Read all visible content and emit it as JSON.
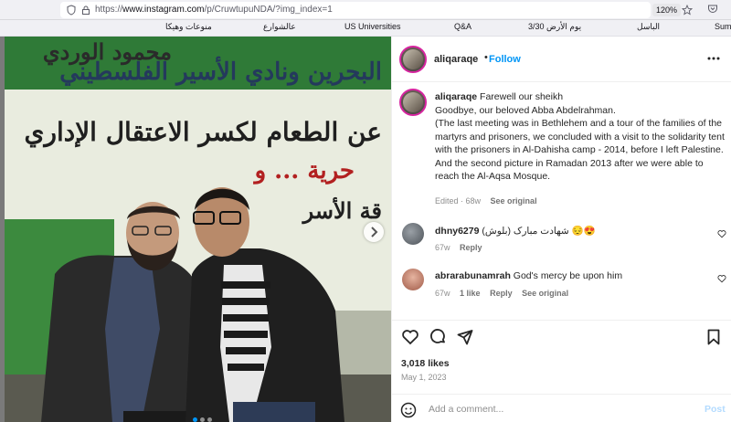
{
  "browser": {
    "url_prefix": "https://",
    "url_host": "www.instagram.com",
    "url_path": "/p/CruwtupuNDA/?img_index=1",
    "zoom": "120%",
    "bookmarks": [
      "Sum",
      "الباسل",
      "يوم الأرض 3/30",
      "Q&A",
      "US Universities",
      "عالشوارع",
      "منوعات وهيكا"
    ]
  },
  "post": {
    "username": "aliqaraqe",
    "follow_label": "Follow",
    "caption_lines": [
      "Farewell our sheikh",
      "Goodbye, our beloved Abba Abdelrahman.",
      "(The last meeting was in Bethlehem and a tour of the families of the martyrs and prisoners, we concluded with a visit to the solidarity tent with the prisoners in Al-Dahisha camp - 2014, before I left Palestine.",
      "And the second picture in Ramadan 2013 after we were able to reach the Al-Aqsa Mosque."
    ],
    "caption_meta": {
      "edited": "Edited · 68w",
      "see_original": "See original"
    },
    "comments": [
      {
        "username": "dhny6279",
        "text": "شهادت مبارک (بلوش) 😔😍",
        "time": "67w",
        "likes": "",
        "reply": "Reply",
        "see_original": ""
      },
      {
        "username": "abrarabunamrah",
        "text": "God's mercy be upon him",
        "time": "67w",
        "likes": "1 like",
        "reply": "Reply",
        "see_original": "See original"
      }
    ],
    "likes": "3,018 likes",
    "date": "May 1, 2023",
    "comment_placeholder": "Add a comment...",
    "post_label": "Post"
  },
  "photo": {
    "banner_lines": [
      "محمود الوردي",
      "البحرين ونادي الأسير الفلسطيني",
      "عن الطعام لكسر الاعتقال الإداري",
      "حرية ... و",
      "قة الأسر"
    ],
    "carousel_count": 3,
    "carousel_active": 0
  },
  "icons": {
    "address": [
      "shield-icon",
      "lock-icon",
      "star-icon",
      "pocket-icon"
    ],
    "actions": [
      "heart-icon",
      "comment-icon",
      "share-icon",
      "bookmark-icon",
      "more-icon",
      "emoji-icon",
      "chevron-right-icon"
    ]
  },
  "colors": {
    "accent": "#0095f6",
    "text": "#262626",
    "muted": "#8e8e8e",
    "post_disabled": "#b3dbff"
  }
}
